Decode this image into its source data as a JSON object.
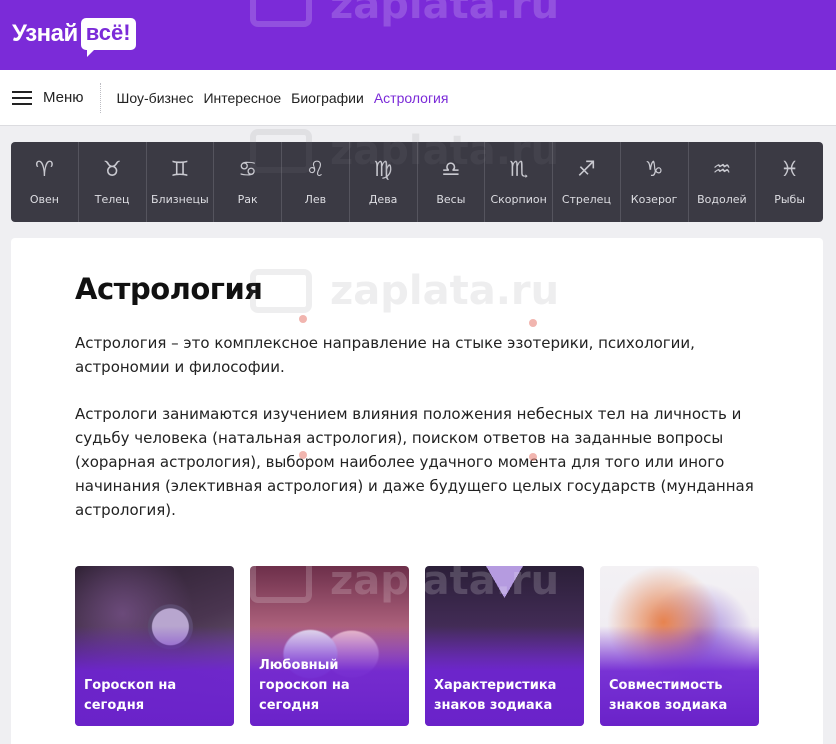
{
  "header": {
    "logo_word": "Узнай",
    "logo_box": "всё!",
    "watermark": "zaplata.ru"
  },
  "nav": {
    "menu_label": "Меню",
    "links": [
      {
        "label": "Шоу-бизнес",
        "active": false
      },
      {
        "label": "Интересное",
        "active": false
      },
      {
        "label": "Биографии",
        "active": false
      },
      {
        "label": "Астрология",
        "active": true
      }
    ]
  },
  "zodiac": [
    {
      "name": "Овен",
      "icon": "aries-icon",
      "symbol": "♈"
    },
    {
      "name": "Телец",
      "icon": "taurus-icon",
      "symbol": "♉"
    },
    {
      "name": "Близнецы",
      "icon": "gemini-icon",
      "symbol": "♊"
    },
    {
      "name": "Рак",
      "icon": "cancer-icon",
      "symbol": "♋"
    },
    {
      "name": "Лев",
      "icon": "leo-icon",
      "symbol": "♌"
    },
    {
      "name": "Дева",
      "icon": "virgo-icon",
      "symbol": "♍"
    },
    {
      "name": "Весы",
      "icon": "libra-icon",
      "symbol": "♎"
    },
    {
      "name": "Скорпион",
      "icon": "scorpio-icon",
      "symbol": "♏"
    },
    {
      "name": "Стрелец",
      "icon": "sagittarius-icon",
      "symbol": "♐"
    },
    {
      "name": "Козерог",
      "icon": "capricorn-icon",
      "symbol": "♑"
    },
    {
      "name": "Водолей",
      "icon": "aquarius-icon",
      "symbol": "♒"
    },
    {
      "name": "Рыбы",
      "icon": "pisces-icon",
      "symbol": "♓"
    }
  ],
  "main": {
    "title": "Астрология",
    "paragraphs": [
      "Астрология – это комплексное направление на стыке эзотерики, психологии, астрономии и философии.",
      "Астрологи занимаются изучением влияния положения небесных тел на личность и судьбу человека (натальная астрология), поиском ответов на заданные вопросы (хорарная астрология), выбором наиболее удачного момента для того или иного начинания (элективная астрология) и даже будущего целых государств (мунданная астрология)."
    ],
    "cards": [
      {
        "title": "Гороскоп на сегодня"
      },
      {
        "title": "Любовный гороскоп на сегодня"
      },
      {
        "title": "Характеристика знаков зодиака"
      },
      {
        "title": "Совместимость знаков зодиака"
      }
    ]
  },
  "colors": {
    "brand": "#7b2bd8",
    "zodiac_bg": "#3b3a44",
    "active_link": "#7b2bd8"
  }
}
